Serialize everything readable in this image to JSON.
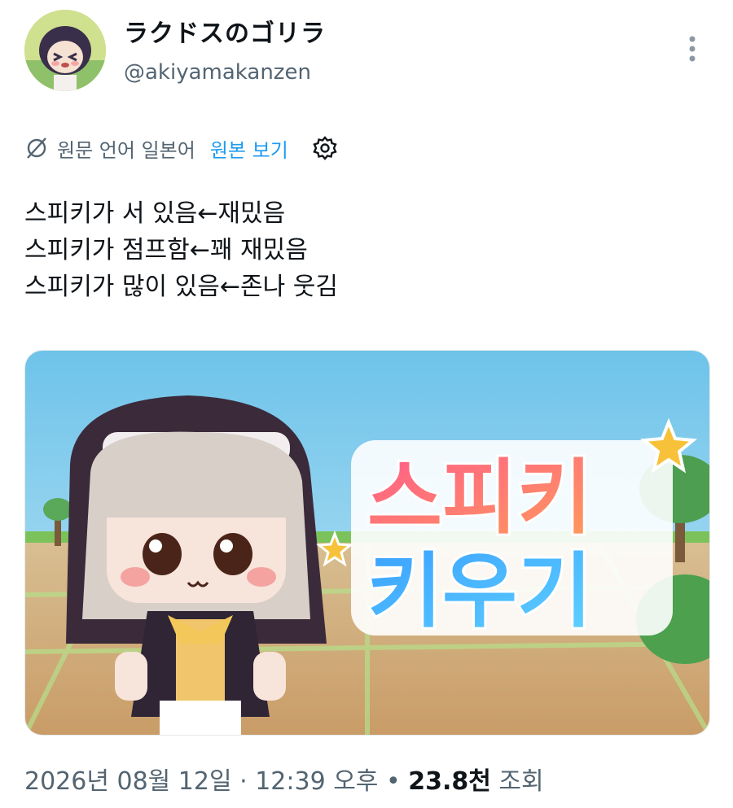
{
  "author": {
    "display_name": "ラクドスのゴリラ",
    "handle": "@akiyamakanzen"
  },
  "translation_bar": {
    "icon": "translate-icon",
    "label": "원문 언어 일본어",
    "link": "원본 보기",
    "settings_icon": "gear-icon"
  },
  "tweet": {
    "lines": [
      "스피키가 서 있음←재밌음",
      "스피키가 점프함←꽤 재밌음",
      "스피키가 많이 있음←존나 웃김"
    ]
  },
  "media": {
    "title_line1": "스피키",
    "title_line2": "키우기"
  },
  "meta": {
    "date": "2026년 08월 12일",
    "sep1": "·",
    "time": "12:39 오후",
    "sep2": "•",
    "views_count": "23.8천",
    "views_label": "조회"
  },
  "colors": {
    "link": "#1d9bf0",
    "muted": "#536471",
    "text": "#0f1419"
  }
}
